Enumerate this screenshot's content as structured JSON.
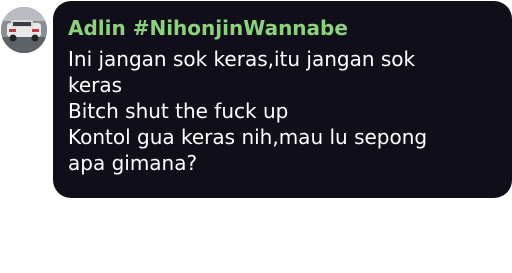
{
  "message": {
    "sender_name": "Adlin #NihonjinWannabe",
    "lines": [
      "Ini jangan sok keras,itu jangan sok",
      "keras",
      "Bitch shut the fuck up",
      "Kontol gua keras nih,mau lu sepong",
      "apa gimana?"
    ]
  },
  "colors": {
    "bubble_background": "#100f19",
    "sender_name": "#8bd37a",
    "message_text": "#ffffff"
  },
  "icons": {
    "avatar": "profile-photo-car"
  }
}
